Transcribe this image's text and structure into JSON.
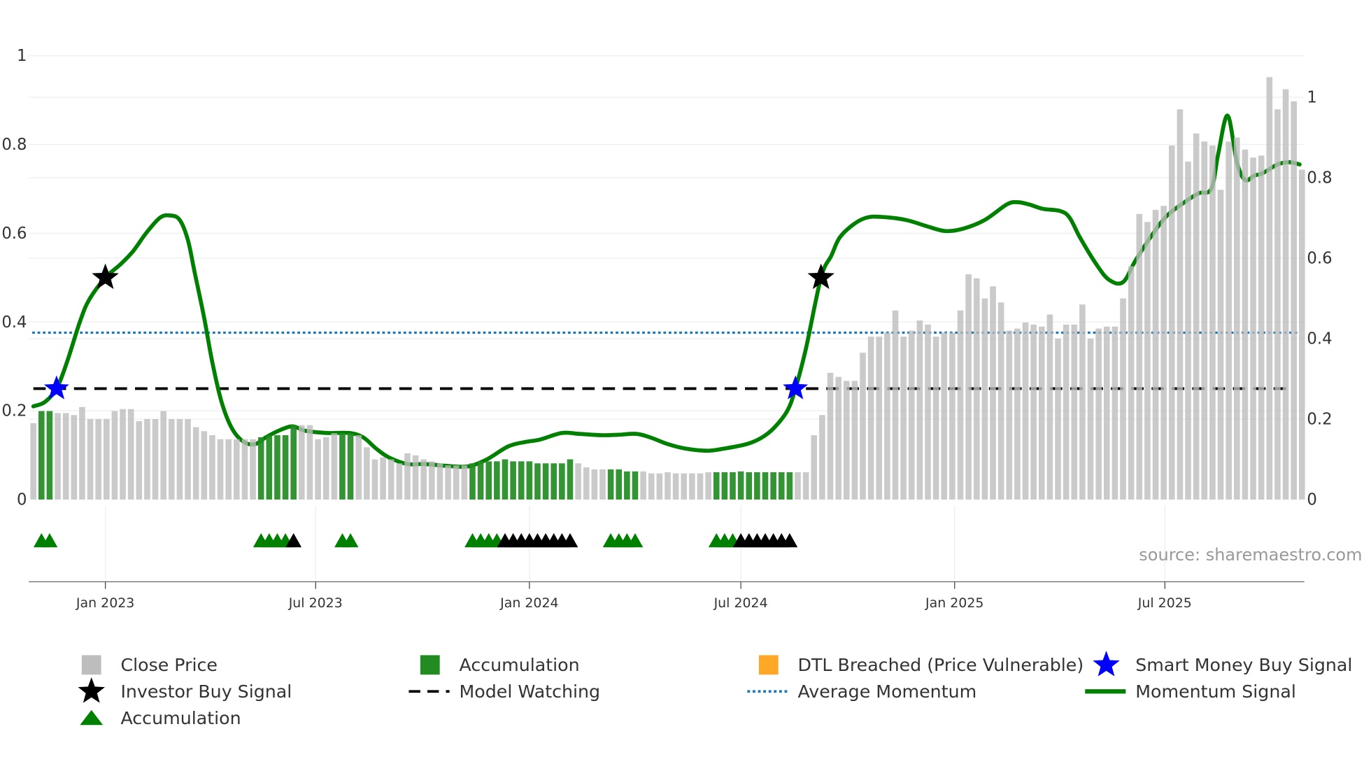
{
  "chart_data": {
    "type": "bar+line",
    "title": "",
    "xlabel": "",
    "ylabel_left": "",
    "ylabel_right": "",
    "xlim": [
      "2022-10-27",
      "2025-10-29"
    ],
    "x_ticks": [
      {
        "date": "2023-01-01",
        "label": "Jan 2023"
      },
      {
        "date": "2023-07-01",
        "label": "Jul 2023"
      },
      {
        "date": "2024-01-01",
        "label": "Jan 2024"
      },
      {
        "date": "2024-07-01",
        "label": "Jul 2024"
      },
      {
        "date": "2025-01-01",
        "label": "Jan 2025"
      },
      {
        "date": "2025-07-01",
        "label": "Jul 2025"
      }
    ],
    "y_left": {
      "ylim": [
        0,
        1
      ],
      "ticks": [
        0,
        0.2,
        0.4,
        0.6,
        0.8,
        1
      ],
      "labels": [
        "0",
        "0.2",
        "0.4",
        "0.6",
        "0.8",
        "1"
      ]
    },
    "y_right": {
      "ylim": [
        0,
        1.1
      ],
      "ticks": [
        0,
        0.2,
        0.4,
        0.6,
        0.8,
        1
      ],
      "labels": [
        "0",
        "0.2",
        "0.4",
        "0.6",
        "0.8",
        "1"
      ]
    },
    "grid": true,
    "legend_placement": "bottom",
    "colors": {
      "close": "#bdbdbd",
      "accumulation": "#228b22",
      "dtl": "#ffa726",
      "smart_money": "#0000ff",
      "investor": "#000000",
      "model_watching": "#000000",
      "average_momentum": "#1f77b4",
      "momentum": "#008000",
      "triangle_green": "#008000",
      "triangle_black": "#000000"
    },
    "close_price": {
      "axis": "right",
      "first_date": "2022-10-31",
      "frequency": "weekly",
      "values": [
        0.19,
        0.22,
        0.22,
        0.215,
        0.215,
        0.21,
        0.23,
        0.2,
        0.2,
        0.2,
        0.22,
        0.225,
        0.225,
        0.195,
        0.2,
        0.2,
        0.22,
        0.2,
        0.2,
        0.2,
        0.18,
        0.17,
        0.16,
        0.15,
        0.15,
        0.15,
        0.15,
        0.15,
        0.155,
        0.16,
        0.16,
        0.16,
        0.185,
        0.185,
        0.185,
        0.15,
        0.155,
        0.165,
        0.165,
        0.165,
        0.16,
        0.13,
        0.1,
        0.105,
        0.1,
        0.09,
        0.115,
        0.11,
        0.1,
        0.095,
        0.09,
        0.085,
        0.085,
        0.085,
        0.09,
        0.095,
        0.095,
        0.095,
        0.1,
        0.095,
        0.095,
        0.095,
        0.09,
        0.09,
        0.09,
        0.09,
        0.1,
        0.09,
        0.08,
        0.075,
        0.075,
        0.075,
        0.075,
        0.07,
        0.07,
        0.07,
        0.065,
        0.065,
        0.068,
        0.065,
        0.065,
        0.065,
        0.065,
        0.068,
        0.068,
        0.068,
        0.068,
        0.07,
        0.068,
        0.068,
        0.068,
        0.068,
        0.068,
        0.068,
        0.068,
        0.068,
        0.16,
        0.21,
        0.315,
        0.305,
        0.295,
        0.295,
        0.365,
        0.405,
        0.405,
        0.415,
        0.47,
        0.405,
        0.42,
        0.445,
        0.435,
        0.405,
        0.415,
        0.415,
        0.47,
        0.56,
        0.55,
        0.5,
        0.53,
        0.49,
        0.42,
        0.425,
        0.44,
        0.435,
        0.43,
        0.46,
        0.4,
        0.435,
        0.435,
        0.485,
        0.4,
        0.425,
        0.43,
        0.43,
        0.5,
        0.58,
        0.71,
        0.69,
        0.72,
        0.73,
        0.88,
        0.97,
        0.84,
        0.91,
        0.89,
        0.88,
        0.77,
        0.89,
        0.9,
        0.87,
        0.85,
        0.855,
        1.05,
        0.97,
        1.02,
        0.99,
        0.82
      ]
    },
    "accumulation_periods": [
      {
        "from": "2022-11-07",
        "to": "2022-11-14",
        "green_triangles_until": "2022-11-14"
      },
      {
        "from": "2023-05-15",
        "to": "2023-06-12",
        "green_triangles_until": "2023-06-05"
      },
      {
        "from": "2023-07-24",
        "to": "2023-07-31",
        "green_triangles_until": "2023-07-31"
      },
      {
        "from": "2023-11-13",
        "to": "2024-02-05",
        "green_triangles_until": "2023-12-04"
      },
      {
        "from": "2024-03-11",
        "to": "2024-04-01",
        "green_triangles_until": "2024-04-01"
      },
      {
        "from": "2024-06-10",
        "to": "2024-08-12",
        "green_triangles_until": "2024-06-24"
      }
    ],
    "momentum_signal": {
      "axis": "left",
      "points": [
        [
          "2022-10-31",
          0.21
        ],
        [
          "2022-11-10",
          0.22
        ],
        [
          "2022-11-20",
          0.25
        ],
        [
          "2022-11-29",
          0.31
        ],
        [
          "2022-12-10",
          0.4
        ],
        [
          "2022-12-18",
          0.45
        ],
        [
          "2023-01-01",
          0.5
        ],
        [
          "2023-01-14",
          0.53
        ],
        [
          "2023-01-25",
          0.56
        ],
        [
          "2023-02-05",
          0.6
        ],
        [
          "2023-02-17",
          0.635
        ],
        [
          "2023-02-26",
          0.64
        ],
        [
          "2023-03-06",
          0.63
        ],
        [
          "2023-03-13",
          0.585
        ],
        [
          "2023-03-19",
          0.51
        ],
        [
          "2023-03-27",
          0.41
        ],
        [
          "2023-04-03",
          0.31
        ],
        [
          "2023-04-11",
          0.22
        ],
        [
          "2023-04-20",
          0.16
        ],
        [
          "2023-04-30",
          0.13
        ],
        [
          "2023-05-10",
          0.125
        ],
        [
          "2023-05-19",
          0.14
        ],
        [
          "2023-05-30",
          0.155
        ],
        [
          "2023-06-11",
          0.165
        ],
        [
          "2023-06-22",
          0.155
        ],
        [
          "2023-07-11",
          0.15
        ],
        [
          "2023-07-30",
          0.15
        ],
        [
          "2023-08-11",
          0.14
        ],
        [
          "2023-08-22",
          0.115
        ],
        [
          "2023-09-02",
          0.095
        ],
        [
          "2023-09-18",
          0.08
        ],
        [
          "2023-10-03",
          0.08
        ],
        [
          "2023-10-26",
          0.075
        ],
        [
          "2023-11-10",
          0.075
        ],
        [
          "2023-11-25",
          0.09
        ],
        [
          "2023-12-14",
          0.12
        ],
        [
          "2023-12-29",
          0.13
        ],
        [
          "2024-01-10",
          0.135
        ],
        [
          "2024-01-29",
          0.15
        ],
        [
          "2024-02-13",
          0.148
        ],
        [
          "2024-03-03",
          0.145
        ],
        [
          "2024-03-18",
          0.146
        ],
        [
          "2024-04-02",
          0.148
        ],
        [
          "2024-04-14",
          0.14
        ],
        [
          "2024-04-29",
          0.125
        ],
        [
          "2024-05-14",
          0.115
        ],
        [
          "2024-06-02",
          0.11
        ],
        [
          "2024-06-17",
          0.115
        ],
        [
          "2024-07-06",
          0.125
        ],
        [
          "2024-07-18",
          0.138
        ],
        [
          "2024-07-29",
          0.16
        ],
        [
          "2024-08-10",
          0.2
        ],
        [
          "2024-08-17",
          0.25
        ],
        [
          "2024-08-26",
          0.34
        ],
        [
          "2024-09-08",
          0.5
        ],
        [
          "2024-09-17",
          0.55
        ],
        [
          "2024-09-24",
          0.59
        ],
        [
          "2024-10-06",
          0.62
        ],
        [
          "2024-10-17",
          0.635
        ],
        [
          "2024-10-29",
          0.637
        ],
        [
          "2024-11-20",
          0.63
        ],
        [
          "2024-12-09",
          0.615
        ],
        [
          "2024-12-24",
          0.605
        ],
        [
          "2025-01-08",
          0.61
        ],
        [
          "2025-01-27",
          0.63
        ],
        [
          "2025-02-15",
          0.665
        ],
        [
          "2025-02-24",
          0.67
        ],
        [
          "2025-03-06",
          0.665
        ],
        [
          "2025-03-18",
          0.655
        ],
        [
          "2025-04-02",
          0.65
        ],
        [
          "2025-04-10",
          0.635
        ],
        [
          "2025-04-19",
          0.59
        ],
        [
          "2025-05-03",
          0.53
        ],
        [
          "2025-05-14",
          0.495
        ],
        [
          "2025-05-26",
          0.49
        ],
        [
          "2025-06-06",
          0.54
        ],
        [
          "2025-06-21",
          0.6
        ],
        [
          "2025-07-03",
          0.64
        ],
        [
          "2025-07-18",
          0.67
        ],
        [
          "2025-07-30",
          0.69
        ],
        [
          "2025-08-10",
          0.7
        ],
        [
          "2025-08-16",
          0.78
        ],
        [
          "2025-08-24",
          0.865
        ],
        [
          "2025-09-01",
          0.76
        ],
        [
          "2025-09-08",
          0.72
        ],
        [
          "2025-09-16",
          0.73
        ],
        [
          "2025-09-23",
          0.735
        ],
        [
          "2025-10-06",
          0.755
        ],
        [
          "2025-10-16",
          0.76
        ],
        [
          "2025-10-25",
          0.755
        ]
      ]
    },
    "model_watching": {
      "value": 0.25,
      "from": "2022-10-31",
      "to": "2025-10-16"
    },
    "average_momentum": {
      "value": 0.376
    },
    "investor_buy_signals": [
      [
        "2023-01-01",
        0.5
      ],
      [
        "2024-09-08",
        0.5
      ]
    ],
    "smart_money_buy_signals": [
      [
        "2022-11-20",
        0.25
      ],
      [
        "2024-08-17",
        0.25
      ]
    ],
    "source_annotation": "source: sharemaestro.com",
    "legend": [
      {
        "label": "Close Price",
        "marker": "square",
        "color": "#bdbdbd"
      },
      {
        "label": "Accumulation",
        "marker": "square",
        "color": "#228b22"
      },
      {
        "label": "DTL Breached (Price Vulnerable)",
        "marker": "square",
        "color": "#ffa726"
      },
      {
        "label": "Smart Money Buy Signal",
        "marker": "star",
        "color": "#0000ff"
      },
      {
        "label": "Investor Buy Signal",
        "marker": "star",
        "color": "#000000"
      },
      {
        "label": "Model Watching",
        "marker": "dash",
        "color": "#000000"
      },
      {
        "label": "Average Momentum",
        "marker": "dot",
        "color": "#1f77b4"
      },
      {
        "label": "Momentum Signal",
        "marker": "line",
        "color": "#008000"
      },
      {
        "label": "Accumulation",
        "marker": "triangle",
        "color": "#008000"
      }
    ]
  }
}
